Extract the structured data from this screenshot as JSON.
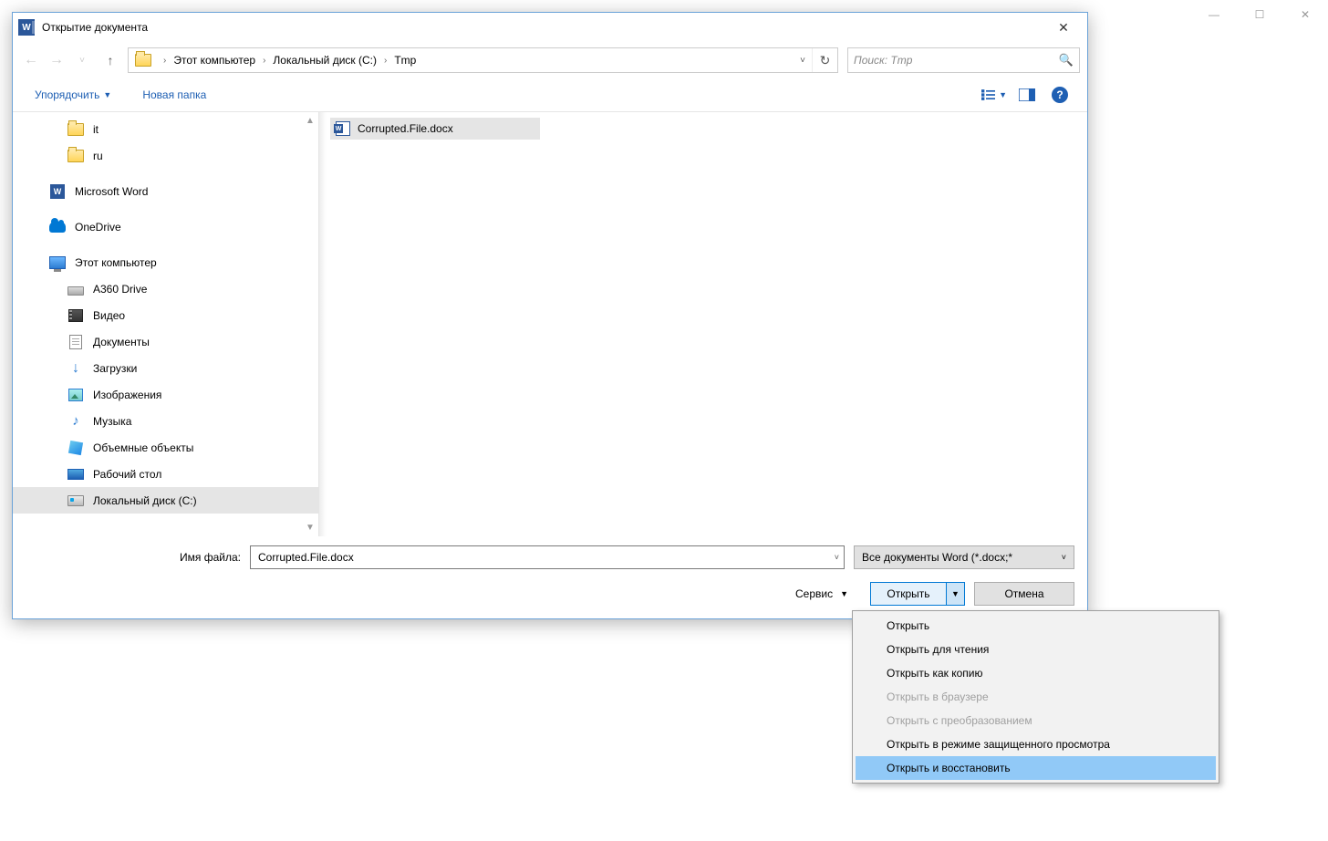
{
  "dialog": {
    "title": "Открытие документа"
  },
  "nav": {
    "breadcrumbs": [
      "Этот компьютер",
      "Локальный диск (C:)",
      "Tmp"
    ],
    "search_placeholder": "Поиск: Tmp"
  },
  "toolbar": {
    "organize": "Упорядочить",
    "new_folder": "Новая папка"
  },
  "sidebar": {
    "items": [
      {
        "label": "it",
        "icon": "folder",
        "level": 1
      },
      {
        "label": "ru",
        "icon": "folder",
        "level": 1
      },
      {
        "label": "Microsoft Word",
        "icon": "word",
        "level": 0
      },
      {
        "label": "OneDrive",
        "icon": "onedrive",
        "level": 0
      },
      {
        "label": "Этот компьютер",
        "icon": "pc",
        "level": 0
      },
      {
        "label": "A360 Drive",
        "icon": "drive",
        "level": 1
      },
      {
        "label": "Видео",
        "icon": "video",
        "level": 1
      },
      {
        "label": "Документы",
        "icon": "doc",
        "level": 1
      },
      {
        "label": "Загрузки",
        "icon": "download",
        "level": 1
      },
      {
        "label": "Изображения",
        "icon": "image",
        "level": 1
      },
      {
        "label": "Музыка",
        "icon": "music",
        "level": 1
      },
      {
        "label": "Объемные объекты",
        "icon": "3d",
        "level": 1
      },
      {
        "label": "Рабочий стол",
        "icon": "desktop",
        "level": 1
      },
      {
        "label": "Локальный диск (C:)",
        "icon": "disk",
        "level": 1,
        "selected": true
      }
    ]
  },
  "files": {
    "items": [
      {
        "name": "Corrupted.File.docx",
        "selected": true
      }
    ]
  },
  "footer": {
    "filename_label": "Имя файла:",
    "filename_value": "Corrupted.File.docx",
    "filter_label": "Все документы Word (*.docx;*",
    "tools_label": "Сервис",
    "open_label": "Открыть",
    "cancel_label": "Отмена"
  },
  "open_menu": {
    "items": [
      {
        "label": "Открыть"
      },
      {
        "label": "Открыть для чтения"
      },
      {
        "label": "Открыть как копию"
      },
      {
        "label": "Открыть в браузере",
        "disabled": true
      },
      {
        "label": "Открыть с преобразованием",
        "disabled": true
      },
      {
        "label": "Открыть в режиме защищенного просмотра"
      },
      {
        "label": "Открыть и восстановить",
        "highlighted": true
      }
    ]
  },
  "bg_controls": {
    "min": "—",
    "max": "☐",
    "close": "✕"
  }
}
